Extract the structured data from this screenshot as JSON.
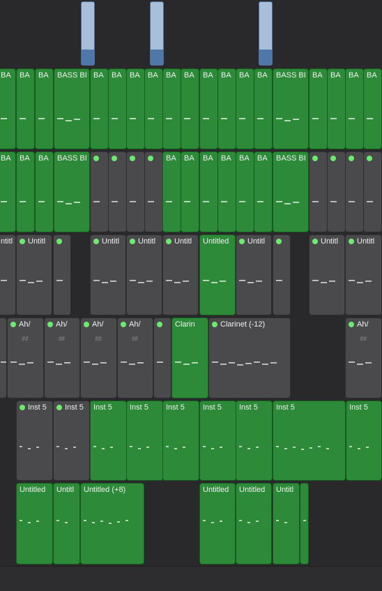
{
  "lanes": [
    {
      "regions": [
        {
          "type": "audio",
          "label": ""
        },
        {
          "type": "audio",
          "label": ""
        },
        {
          "type": "audio",
          "label": ""
        }
      ]
    },
    {
      "regions": [
        {
          "type": "green",
          "label": "BA"
        },
        {
          "type": "green",
          "label": "BA"
        },
        {
          "type": "green",
          "label": "BA"
        },
        {
          "type": "green",
          "label": "BASS BI"
        },
        {
          "type": "green",
          "label": "BA"
        },
        {
          "type": "green",
          "label": "BA"
        },
        {
          "type": "green",
          "label": "BA"
        },
        {
          "type": "green",
          "label": "BA"
        },
        {
          "type": "green",
          "label": "BA"
        },
        {
          "type": "green",
          "label": "BA"
        },
        {
          "type": "green",
          "label": "BA"
        },
        {
          "type": "green",
          "label": "BA"
        },
        {
          "type": "green",
          "label": "BA"
        },
        {
          "type": "green",
          "label": "BA"
        },
        {
          "type": "green",
          "label": "BASS BI"
        },
        {
          "type": "green",
          "label": "BA"
        },
        {
          "type": "green",
          "label": "BA"
        },
        {
          "type": "green",
          "label": "BA"
        },
        {
          "type": "green",
          "label": "BA"
        }
      ]
    },
    {
      "regions": [
        {
          "type": "green",
          "label": "BA"
        },
        {
          "type": "green",
          "label": "BA"
        },
        {
          "type": "green",
          "label": "BA"
        },
        {
          "type": "green",
          "label": "BASS BI"
        },
        {
          "type": "gray",
          "label": "",
          "dot": true
        },
        {
          "type": "gray",
          "label": "",
          "dot": true
        },
        {
          "type": "gray",
          "label": "",
          "dot": true
        },
        {
          "type": "gray",
          "label": "",
          "dot": true
        },
        {
          "type": "green",
          "label": "BA"
        },
        {
          "type": "green",
          "label": "BA"
        },
        {
          "type": "green",
          "label": "BA"
        },
        {
          "type": "green",
          "label": "BA"
        },
        {
          "type": "green",
          "label": "BA"
        },
        {
          "type": "green",
          "label": "BA"
        },
        {
          "type": "green",
          "label": "BASS BI"
        },
        {
          "type": "gray",
          "label": "",
          "dot": true
        },
        {
          "type": "gray",
          "label": "",
          "dot": true
        },
        {
          "type": "gray",
          "label": "",
          "dot": true
        },
        {
          "type": "gray",
          "label": "",
          "dot": true
        }
      ]
    },
    {
      "regions": [
        {
          "type": "gray",
          "label": "ntitl"
        },
        {
          "type": "gray",
          "label": "Untitl",
          "dot": true
        },
        {
          "type": "gray",
          "label": "",
          "dot": true
        },
        {
          "type": "gray",
          "label": "Untitl",
          "dot": true
        },
        {
          "type": "gray",
          "label": "Untitl",
          "dot": true
        },
        {
          "type": "gray",
          "label": "Untitl",
          "dot": true
        },
        {
          "type": "green",
          "label": "Untitled"
        },
        {
          "type": "gray",
          "label": "Untitl",
          "dot": true
        },
        {
          "type": "gray",
          "label": "",
          "dot": true
        },
        {
          "type": "gray",
          "label": "Untitl",
          "dot": true
        },
        {
          "type": "gray",
          "label": "Untitl",
          "dot": true
        }
      ]
    },
    {
      "regions": [
        {
          "type": "gray",
          "label": ""
        },
        {
          "type": "gray",
          "label": "Ah/",
          "dot": true
        },
        {
          "type": "gray",
          "label": "Ah/",
          "dot": true
        },
        {
          "type": "gray",
          "label": "Ah/",
          "dot": true
        },
        {
          "type": "gray",
          "label": "Ah/",
          "dot": true
        },
        {
          "type": "gray",
          "label": "",
          "dot": true
        },
        {
          "type": "green",
          "label": "Clarin"
        },
        {
          "type": "gray",
          "label": "Clarinet (-12)",
          "dot": true
        },
        {
          "type": "gray",
          "label": "Ah/",
          "dot": true
        }
      ]
    },
    {
      "regions": [
        {
          "type": "gray",
          "label": "Inst 5",
          "dot": true
        },
        {
          "type": "gray",
          "label": "Inst 5",
          "dot": true
        },
        {
          "type": "green",
          "label": "Inst 5"
        },
        {
          "type": "green",
          "label": "Inst 5"
        },
        {
          "type": "green",
          "label": "Inst 5"
        },
        {
          "type": "green",
          "label": "Inst 5"
        },
        {
          "type": "green",
          "label": "Inst 5"
        },
        {
          "type": "green",
          "label": "Inst 5"
        },
        {
          "type": "green",
          "label": "Inst 5"
        }
      ]
    },
    {
      "regions": [
        {
          "type": "green",
          "label": "Untitled"
        },
        {
          "type": "green",
          "label": "Untitl"
        },
        {
          "type": "green",
          "label": "Untitled (+8)"
        },
        {
          "type": "green",
          "label": "Untitled"
        },
        {
          "type": "green",
          "label": "Untitled"
        },
        {
          "type": "green",
          "label": "Untitl"
        },
        {
          "type": "green",
          "label": ""
        }
      ]
    }
  ]
}
